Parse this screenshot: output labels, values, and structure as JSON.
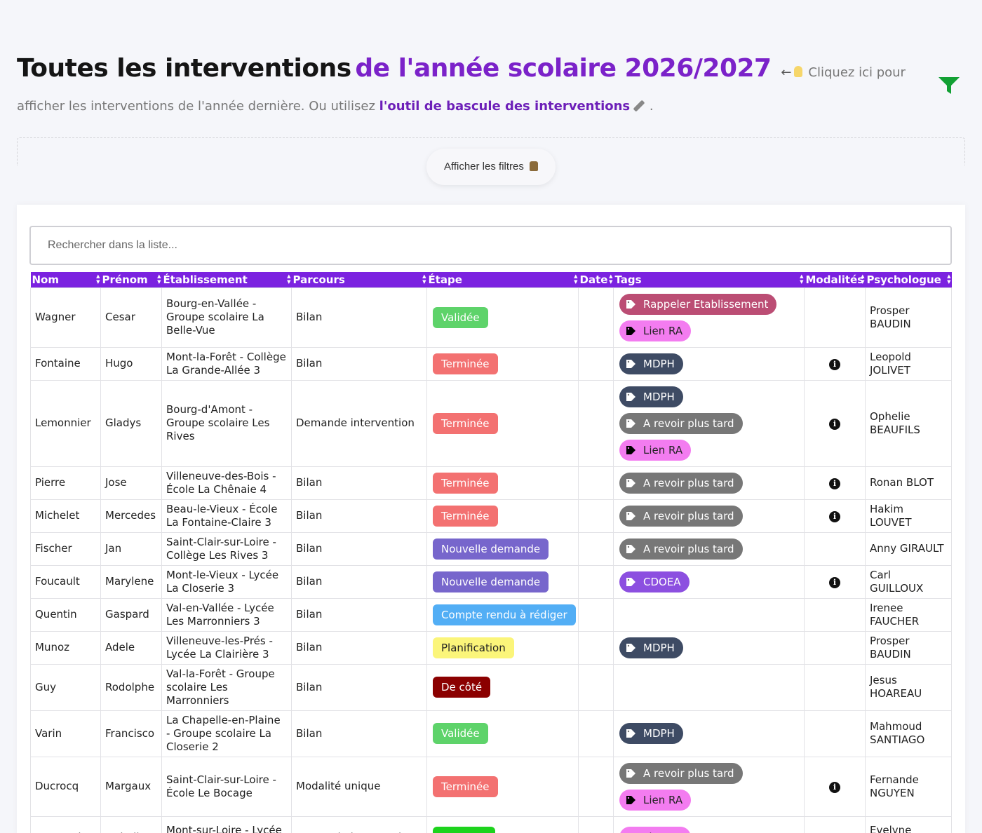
{
  "header": {
    "title_part1": "Toutes les interventions",
    "title_part2": "de l'année scolaire 2026/2027",
    "arrow": "←",
    "hint_part1": "Cliquez ici pour afficher les interventions de l'année dernière. Ou utilisez",
    "hint_link": "l'outil de bascule des interventions",
    "hint_end": "."
  },
  "filters": {
    "button_label": "Afficher les filtres"
  },
  "search": {
    "placeholder": "Rechercher dans la liste..."
  },
  "table": {
    "columns": [
      "Nom",
      "Prénom",
      "Établissement",
      "Parcours",
      "Étape",
      "Date",
      "Tags",
      "Modalités",
      "Psychologue"
    ],
    "rows": [
      {
        "nom": "Wagner",
        "prenom": "Cesar",
        "etab": "Bourg-en-Vallée - Groupe scolaire La Belle-Vue",
        "parcours": "Bilan",
        "etape": "Validée",
        "etape_color": "#5ed36a",
        "date": "",
        "tags": [
          {
            "label": "Rappeler Etablissement",
            "color": "#bb4d74",
            "icon_color": "#fff"
          },
          {
            "label": "Lien RA",
            "color": "#f37cf0",
            "icon_color": "#000",
            "dark": true
          }
        ],
        "info": false,
        "psy": "Prosper BAUDIN"
      },
      {
        "nom": "Fontaine",
        "prenom": "Hugo",
        "etab": "Mont-la-Forêt - Collège La Grande-Allée 3",
        "parcours": "Bilan",
        "etape": "Terminée",
        "etape_color": "#f37171",
        "date": "",
        "tags": [
          {
            "label": "MDPH",
            "color": "#3e4b64",
            "icon_color": "#fff"
          }
        ],
        "info": true,
        "psy": "Leopold JOLIVET"
      },
      {
        "nom": "Lemonnier",
        "prenom": "Gladys",
        "etab": "Bourg-d'Amont - Groupe scolaire Les Rives",
        "parcours": "Demande intervention",
        "etape": "Terminée",
        "etape_color": "#f37171",
        "date": "",
        "tags": [
          {
            "label": "MDPH",
            "color": "#3e4b64",
            "icon_color": "#fff"
          },
          {
            "label": "A revoir plus tard",
            "color": "#777777",
            "icon_color": "#fff"
          },
          {
            "label": "Lien RA",
            "color": "#f37cf0",
            "icon_color": "#000",
            "dark": true
          }
        ],
        "info": true,
        "psy": "Ophelie BEAUFILS"
      },
      {
        "nom": "Pierre",
        "prenom": "Jose",
        "etab": "Villeneuve-des-Bois - École La Chênaie 4",
        "parcours": "Bilan",
        "etape": "Terminée",
        "etape_color": "#f37171",
        "date": "",
        "tags": [
          {
            "label": "A revoir plus tard",
            "color": "#777777",
            "icon_color": "#fff"
          }
        ],
        "info": true,
        "psy": "Ronan BLOT"
      },
      {
        "nom": "Michelet",
        "prenom": "Mercedes",
        "etab": "Beau-le-Vieux - École La Fontaine-Claire 3",
        "parcours": "Bilan",
        "etape": "Terminée",
        "etape_color": "#f37171",
        "date": "",
        "tags": [
          {
            "label": "A revoir plus tard",
            "color": "#777777",
            "icon_color": "#fff"
          }
        ],
        "info": true,
        "psy": "Hakim LOUVET"
      },
      {
        "nom": "Fischer",
        "prenom": "Jan",
        "etab": "Saint-Clair-sur-Loire - Collège Les Rives 3",
        "parcours": "Bilan",
        "etape": "Nouvelle demande",
        "etape_color": "#7766cc",
        "date": "",
        "tags": [
          {
            "label": "A revoir plus tard",
            "color": "#777777",
            "icon_color": "#fff"
          }
        ],
        "info": false,
        "psy": "Anny GIRAULT"
      },
      {
        "nom": "Foucault",
        "prenom": "Marylene",
        "etab": "Mont-le-Vieux - Lycée La Closerie 3",
        "parcours": "Bilan",
        "etape": "Nouvelle demande",
        "etape_color": "#7766cc",
        "date": "",
        "tags": [
          {
            "label": "CDOEA",
            "color": "#8c4fe0",
            "icon_color": "#fff"
          }
        ],
        "info": true,
        "psy": "Carl GUILLOUX"
      },
      {
        "nom": "Quentin",
        "prenom": "Gaspard",
        "etab": "Val-en-Vallée - Lycée Les Marronniers 3",
        "parcours": "Bilan",
        "etape": "Compte rendu à rédiger",
        "etape_color": "#52aef5",
        "date": "",
        "tags": [],
        "info": false,
        "psy": "Irenee FAUCHER"
      },
      {
        "nom": "Munoz",
        "prenom": "Adele",
        "etab": "Villeneuve-les-Prés - Lycée La Clairière 3",
        "parcours": "Bilan",
        "etape": "Planification",
        "etape_color": "#fbf57a",
        "etape_dark": true,
        "date": "",
        "tags": [
          {
            "label": "MDPH",
            "color": "#3e4b64",
            "icon_color": "#fff"
          }
        ],
        "info": false,
        "psy": "Prosper BAUDIN"
      },
      {
        "nom": "Guy",
        "prenom": "Rodolphe",
        "etab": "Val-la-Forêt - Groupe scolaire Les Marronniers",
        "parcours": "Bilan",
        "etape": "De côté",
        "etape_color": "#8b0000",
        "date": "",
        "tags": [],
        "info": false,
        "psy": "Jesus HOAREAU"
      },
      {
        "nom": "Varin",
        "prenom": "Francisco",
        "etab": "La Chapelle-en-Plaine - Groupe scolaire La Closerie 2",
        "parcours": "Bilan",
        "etape": "Validée",
        "etape_color": "#5ed36a",
        "date": "",
        "tags": [
          {
            "label": "MDPH",
            "color": "#3e4b64",
            "icon_color": "#fff"
          }
        ],
        "info": false,
        "psy": "Mahmoud SANTIAGO"
      },
      {
        "nom": "Ducrocq",
        "prenom": "Margaux",
        "etab": "Saint-Clair-sur-Loire - École Le Bocage",
        "parcours": "Modalité unique",
        "etape": "Terminée",
        "etape_color": "#f37171",
        "date": "",
        "tags": [
          {
            "label": "A revoir plus tard",
            "color": "#777777",
            "icon_color": "#fff"
          },
          {
            "label": "Lien RA",
            "color": "#f37cf0",
            "icon_color": "#000",
            "dark": true
          }
        ],
        "info": true,
        "psy": "Fernande NGUYEN"
      },
      {
        "nom": "Reynaud",
        "prenom": "Isabelle",
        "etab": "Mont-sur-Loire - Lycée La Roseraie",
        "parcours": "Demande intervention",
        "etape": "En cours",
        "etape_color": "#1dd31d",
        "date": "",
        "tags": [
          {
            "label": "Lien RA",
            "color": "#f37cf0",
            "icon_color": "#000",
            "dark": true
          }
        ],
        "info": true,
        "psy": "Evelyne PERRIN"
      }
    ]
  }
}
